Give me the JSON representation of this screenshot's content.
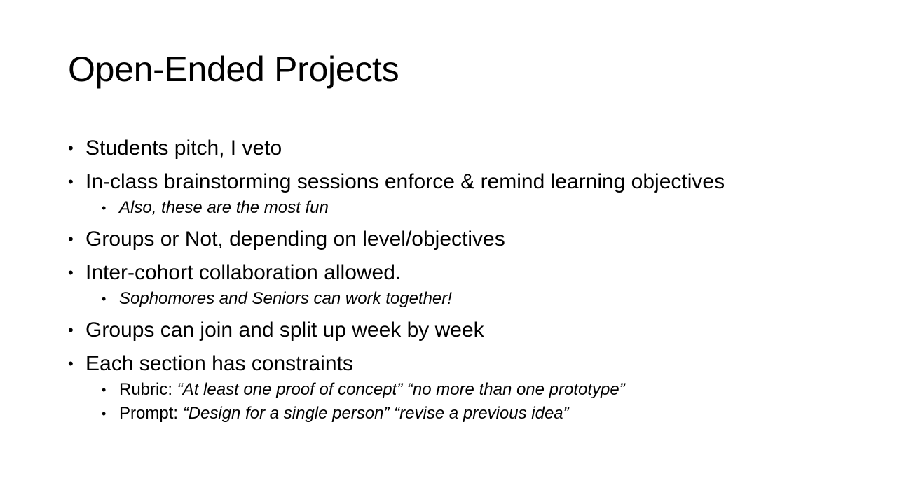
{
  "slide": {
    "title": "Open-Ended Projects",
    "bullet_glyph": "•",
    "items": [
      {
        "text": "Students pitch, I veto"
      },
      {
        "text": "In-class brainstorming sessions enforce & remind learning objectives"
      },
      {
        "sub": {
          "italic": "Also, these are the most fun"
        }
      },
      {
        "text": "Groups or Not, depending on level/objectives"
      },
      {
        "text": "Inter-cohort collaboration allowed."
      },
      {
        "sub": {
          "italic": "Sophomores and Seniors can work together!"
        }
      },
      {
        "text": "Groups can join and split up week by week"
      },
      {
        "text": "Each section has constraints"
      },
      {
        "sub": {
          "prefix": "Rubric: ",
          "italic": "“At least one proof of concept” “no more than one prototype”"
        }
      },
      {
        "sub": {
          "prefix": "Prompt: ",
          "italic": "“Design for a single person” “revise a previous idea”"
        }
      }
    ]
  }
}
